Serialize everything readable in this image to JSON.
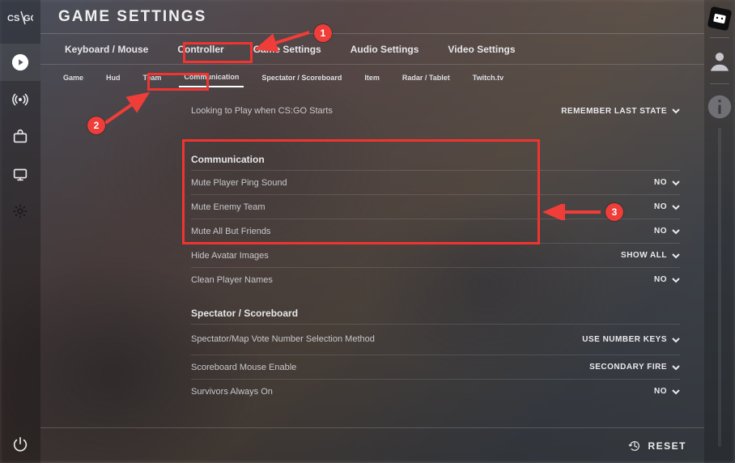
{
  "header": {
    "title": "GAME SETTINGS"
  },
  "main_tabs": [
    "Keyboard / Mouse",
    "Controller",
    "Game Settings",
    "Audio Settings",
    "Video Settings"
  ],
  "main_tabs_active_index": 2,
  "sub_tabs": [
    "Game",
    "Hud",
    "Team",
    "Communication",
    "Spectator / Scoreboard",
    "Item",
    "Radar / Tablet",
    "Twitch.tv"
  ],
  "sub_tabs_active_index": 3,
  "top_row": {
    "label": "Looking to Play when CS:GO Starts",
    "value": "REMEMBER LAST STATE"
  },
  "section_comm": {
    "title": "Communication",
    "rows": [
      {
        "label": "Mute Player Ping Sound",
        "value": "NO"
      },
      {
        "label": "Mute Enemy Team",
        "value": "NO"
      },
      {
        "label": "Mute All But Friends",
        "value": "NO"
      }
    ],
    "extra_rows": [
      {
        "label": "Hide Avatar Images",
        "value": "SHOW ALL"
      },
      {
        "label": "Clean Player Names",
        "value": "NO"
      }
    ]
  },
  "section_spec": {
    "title": "Spectator / Scoreboard",
    "rows": [
      {
        "label": "Spectator/Map Vote Number Selection Method",
        "value": "USE NUMBER KEYS"
      },
      {
        "label": "Scoreboard Mouse Enable",
        "value": "SECONDARY FIRE"
      },
      {
        "label": "Survivors Always On",
        "value": "NO"
      }
    ]
  },
  "footer": {
    "reset": "RESET"
  },
  "annotations": {
    "badges": {
      "one": "1",
      "two": "2",
      "three": "3"
    }
  }
}
